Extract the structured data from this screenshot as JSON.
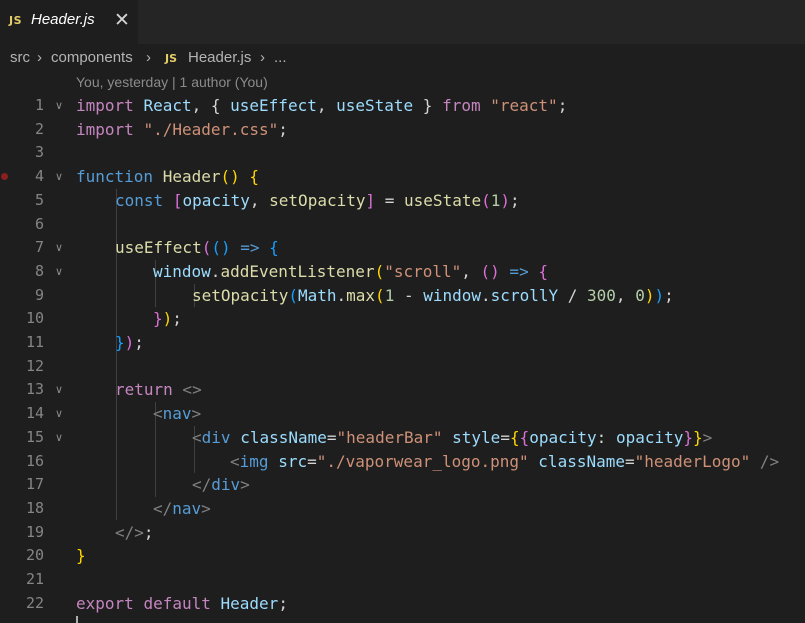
{
  "tab": {
    "icon": "JS",
    "filename": "Header.js",
    "close": "✕"
  },
  "breadcrumb": {
    "p1": "src",
    "p2": "components",
    "icon": "JS",
    "p3": "Header.js",
    "p4": "..."
  },
  "blame": "You, yesterday | 1 author (You)",
  "line_numbers": [
    "1",
    "2",
    "3",
    "4",
    "5",
    "6",
    "7",
    "8",
    "9",
    "10",
    "11",
    "12",
    "13",
    "14",
    "15",
    "16",
    "17",
    "18",
    "19",
    "20",
    "21",
    "22"
  ],
  "code": {
    "l1_import": "import",
    "l1_react": "React",
    "l1_p1": ", { ",
    "l1_ue": "useEffect",
    "l1_comma": ", ",
    "l1_us": "useState",
    "l1_p2": " } ",
    "l1_from": "from",
    "l1_sp": " ",
    "l1_str": "\"react\"",
    "l1_semi": ";",
    "l2_import": "import",
    "l2_sp": " ",
    "l2_str": "\"./Header.css\"",
    "l2_semi": ";",
    "l4_function": "function",
    "l4_sp": " ",
    "l4_name": "Header",
    "l4_paren": "()",
    "l4_rest": " {",
    "l5_const": "const",
    "l5_sp": " ",
    "l5_lb": "[",
    "l5_op": "opacity",
    "l5_c": ", ",
    "l5_set": "setOpacity",
    "l5_rb": "]",
    "l5_eq": " = ",
    "l5_us": "useState",
    "l5_lp": "(",
    "l5_num": "1",
    "l5_rp": ")",
    "l5_semi": ";",
    "l7_ue": "useEffect",
    "l7_lp": "(",
    "l7_ip": "()",
    "l7_arrow": " => ",
    "l7_brace": "{",
    "l8_win": "window",
    "l8_dot": ".",
    "l8_ael": "addEventListener",
    "l8_lp": "(",
    "l8_str": "\"scroll\"",
    "l8_c": ", ",
    "l8_ip": "()",
    "l8_arrow": " => ",
    "l8_brace": "{",
    "l9_set": "setOpacity",
    "l9_lp": "(",
    "l9_math": "Math",
    "l9_dot": ".",
    "l9_max": "max",
    "l9_lp2": "(",
    "l9_num1": "1",
    "l9_minus": " - ",
    "l9_win": "window",
    "l9_dot2": ".",
    "l9_sy": "scrollY",
    "l9_div": " / ",
    "l9_num300": "300",
    "l9_c": ", ",
    "l9_num0": "0",
    "l9_rp2": ")",
    "l9_rp": ")",
    "l9_semi": ";",
    "l10_brace": "}",
    "l10_rp": ")",
    "l10_semi": ";",
    "l11_brace": "}",
    "l11_rp": ")",
    "l11_semi": ";",
    "l13_return": "return",
    "l13_rest": " <>",
    "l14_lt": "<",
    "l14_tag": "nav",
    "l14_gt": ">",
    "l15_lt": "<",
    "l15_tag": "div",
    "l15_sp": " ",
    "l15_attr": "className",
    "l15_eq": "=",
    "l15_str": "\"headerBar\"",
    "l15_sp2": " ",
    "l15_attr2": "style",
    "l15_eq2": "=",
    "l15_ob1": "{",
    "l15_ob2": "{",
    "l15_key": "opacity",
    "l15_colon": ": ",
    "l15_val": "opacity",
    "l15_cb2": "}",
    "l15_cb1": "}",
    "l15_gt": ">",
    "l16_lt": "<",
    "l16_tag": "img",
    "l16_sp": " ",
    "l16_attr": "src",
    "l16_eq": "=",
    "l16_str": "\"./vaporwear_logo.png\"",
    "l16_sp2": " ",
    "l16_attr2": "className",
    "l16_eq2": "=",
    "l16_str2": "\"headerLogo\"",
    "l16_end": " />",
    "l17_open": "</",
    "l17_tag": "div",
    "l17_gt": ">",
    "l18_open": "</",
    "l18_tag": "nav",
    "l18_gt": ">",
    "l19_frag": "</>",
    "l19_semi": ";",
    "l20_brace": "}",
    "l22_export": "export",
    "l22_sp": " ",
    "l22_default": "default",
    "l22_sp2": " ",
    "l22_name": "Header",
    "l22_semi": ";"
  }
}
